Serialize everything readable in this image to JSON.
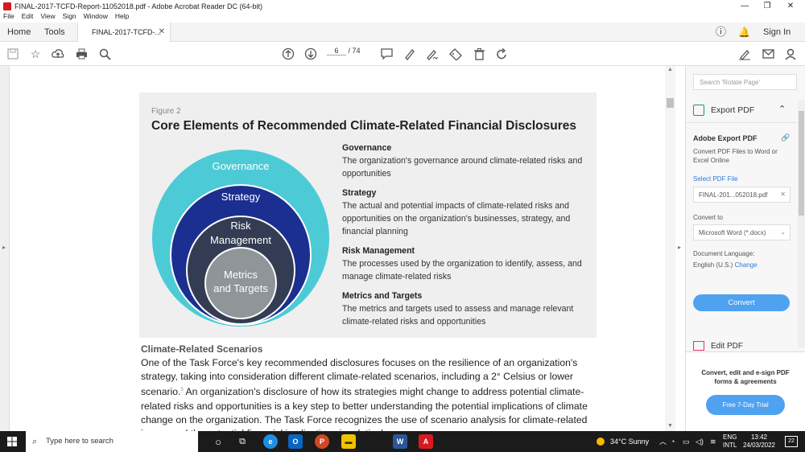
{
  "window": {
    "title": "FINAL-2017-TCFD-Report-11052018.pdf - Adobe Acrobat Reader DC (64-bit)",
    "menu": [
      "File",
      "Edit",
      "View",
      "Sign",
      "Window",
      "Help"
    ]
  },
  "tabs": {
    "home": "Home",
    "tools": "Tools",
    "document": "FINAL-2017-TCFD-...",
    "sign_in": "Sign In"
  },
  "toolbar": {
    "page_current": "6",
    "page_total": "/ 74"
  },
  "figure": {
    "label": "Figure 2",
    "title": "Core Elements of Recommended Climate-Related Financial Disclosures",
    "rings": {
      "outer": "Governance",
      "second": "Strategy",
      "third_line1": "Risk",
      "third_line2": "Management",
      "inner_line1": "Metrics",
      "inner_line2": "and Targets"
    },
    "definitions": [
      {
        "heading": "Governance",
        "text": "The organization's governance around climate-related risks and opportunities"
      },
      {
        "heading": "Strategy",
        "text": "The actual and potential impacts of climate-related risks and opportunities on the organization's businesses, strategy, and financial planning"
      },
      {
        "heading": "Risk Management",
        "text": "The processes used by the organization to identify, assess, and manage climate-related risks"
      },
      {
        "heading": "Metrics and Targets",
        "text": "The metrics and targets used to assess and manage relevant climate-related risks and opportunities"
      }
    ],
    "colors": {
      "outer": "#4ccbd6",
      "second": "#1a2f8f",
      "third": "#333c52",
      "inner": "#8f9599"
    }
  },
  "body": {
    "heading": "Climate-Related Scenarios",
    "paragraph_pre": "One of the Task Force's key recommended disclosures focuses on the resilience of an organization's strategy, taking into consideration different climate-related scenarios, including a 2° Celsius or lower scenario.",
    "footnote": "5",
    "paragraph_post": " An organization's disclosure of how its strategies might change to address potential climate-related risks and opportunities is a key step to better understanding the potential implications of climate change on the organization. The Task Force recognizes the use of scenario analysis for climate-related issues and the potential financial implications is relatively new"
  },
  "right_panel": {
    "search_placeholder": "Search 'Rotate Page'",
    "export_title": "Export PDF",
    "adobe_export_heading": "Adobe Export PDF",
    "adobe_export_desc": "Convert PDF Files to Word or Excel Online",
    "select_file_label": "Select PDF File",
    "selected_file": "FINAL-201...052018.pdf",
    "convert_to_label": "Convert to",
    "convert_to_value": "Microsoft Word (*.docx)",
    "doc_language_label": "Document Language:",
    "doc_language_value": "English (U.S.)",
    "change_link": "Change",
    "convert_button": "Convert",
    "edit_pdf": "Edit PDF",
    "promo_text": "Convert, edit and e-sign PDF forms & agreements",
    "trial_button": "Free 7-Day Trial"
  },
  "taskbar": {
    "search_placeholder": "Type here to search",
    "weather": "34°C  Sunny",
    "lang_line1": "ENG",
    "lang_line2": "INTL",
    "time": "13:42",
    "date": "24/03/2022",
    "notifications": "22"
  }
}
